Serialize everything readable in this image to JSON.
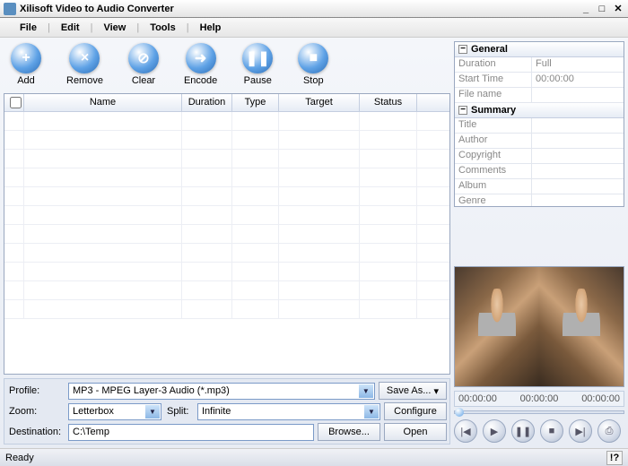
{
  "window": {
    "title": "Xilisoft Video to Audio Converter"
  },
  "menu": {
    "file": "File",
    "edit": "Edit",
    "view": "View",
    "tools": "Tools",
    "help": "Help"
  },
  "toolbar": {
    "add": "Add",
    "remove": "Remove",
    "clear": "Clear",
    "encode": "Encode",
    "pause": "Pause",
    "stop": "Stop"
  },
  "columns": {
    "name": "Name",
    "duration": "Duration",
    "type": "Type",
    "target": "Target",
    "status": "Status"
  },
  "controls": {
    "profile_label": "Profile:",
    "profile_value": "MP3 - MPEG Layer-3 Audio  (*.mp3)",
    "zoom_label": "Zoom:",
    "zoom_value": "Letterbox",
    "split_label": "Split:",
    "split_value": "Infinite",
    "dest_label": "Destination:",
    "dest_value": "C:\\Temp",
    "saveas": "Save As...",
    "configure": "Configure",
    "browse": "Browse...",
    "open": "Open"
  },
  "props": {
    "general": "General",
    "duration_k": "Duration",
    "duration_v": "Full",
    "start_k": "Start Time",
    "start_v": "00:00:00",
    "filename_k": "File name",
    "summary": "Summary",
    "title_k": "Title",
    "author_k": "Author",
    "copyright_k": "Copyright",
    "comments_k": "Comments",
    "album_k": "Album",
    "genre_k": "Genre"
  },
  "time": {
    "t1": "00:00:00",
    "t2": "00:00:00",
    "t3": "00:00:00"
  },
  "status": {
    "ready": "Ready",
    "help": "!?"
  }
}
